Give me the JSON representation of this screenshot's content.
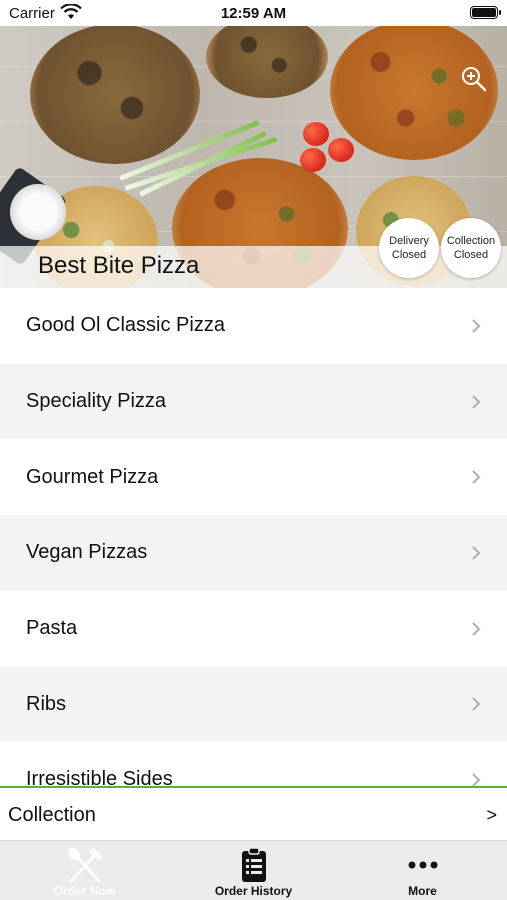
{
  "status_bar": {
    "carrier": "Carrier",
    "time": "12:59 AM",
    "wifi_icon": "wifi-icon",
    "battery_icon": "battery-icon"
  },
  "header": {
    "restaurant_name": "Best Bite Pizza",
    "zoom_icon": "zoom-in-icon",
    "delivery_status": {
      "line1": "Delivery",
      "line2": "Closed"
    },
    "collection_status": {
      "line1": "Collection",
      "line2": "Closed"
    }
  },
  "menu": {
    "categories": [
      {
        "label": "Good Ol Classic Pizza"
      },
      {
        "label": "Speciality Pizza"
      },
      {
        "label": "Gourmet Pizza"
      },
      {
        "label": "Vegan Pizzas"
      },
      {
        "label": "Pasta"
      },
      {
        "label": "Ribs"
      },
      {
        "label": "Irresistible Sides"
      }
    ],
    "chevron_icon": "chevron-right-icon"
  },
  "order_mode": {
    "label": "Collection",
    "arrow": ">",
    "accent_color": "#5fae3e"
  },
  "tab_bar": {
    "tabs": [
      {
        "label": "Order Now",
        "icon": "fork-knife-icon",
        "active": true
      },
      {
        "label": "Order History",
        "icon": "clipboard-list-icon",
        "active": false
      },
      {
        "label": "More",
        "icon": "more-dots-icon",
        "active": false
      }
    ]
  }
}
